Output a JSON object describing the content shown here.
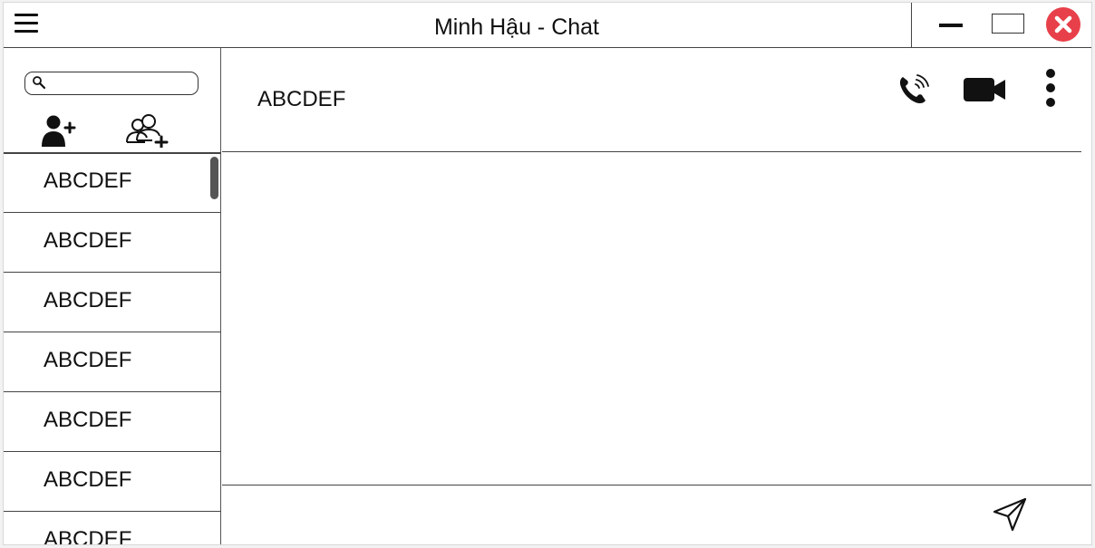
{
  "window": {
    "title": "Minh Hậu - Chat",
    "icons": {
      "menu": "hamburger-menu-icon",
      "minimize": "minimize-icon",
      "maximize": "maximize-icon",
      "close": "close-icon"
    },
    "colors": {
      "close": "#e8404a"
    }
  },
  "sidebar": {
    "search": {
      "placeholder": "",
      "value": "",
      "icon": "search-icon"
    },
    "actions": {
      "add_user_icon": "add-user-icon",
      "add_group_icon": "add-group-icon"
    },
    "contacts": [
      {
        "name": "ABCDEF"
      },
      {
        "name": "ABCDEF"
      },
      {
        "name": "ABCDEF"
      },
      {
        "name": "ABCDEF"
      },
      {
        "name": "ABCDEF"
      },
      {
        "name": "ABCDEF"
      },
      {
        "name": "ABCDEF"
      }
    ]
  },
  "chat": {
    "contact_name": "ABCDEF",
    "actions": {
      "call_icon": "phone-icon",
      "video_icon": "video-camera-icon",
      "more_icon": "more-vertical-icon"
    },
    "composer": {
      "value": "",
      "placeholder": "",
      "send_icon": "send-icon"
    }
  }
}
